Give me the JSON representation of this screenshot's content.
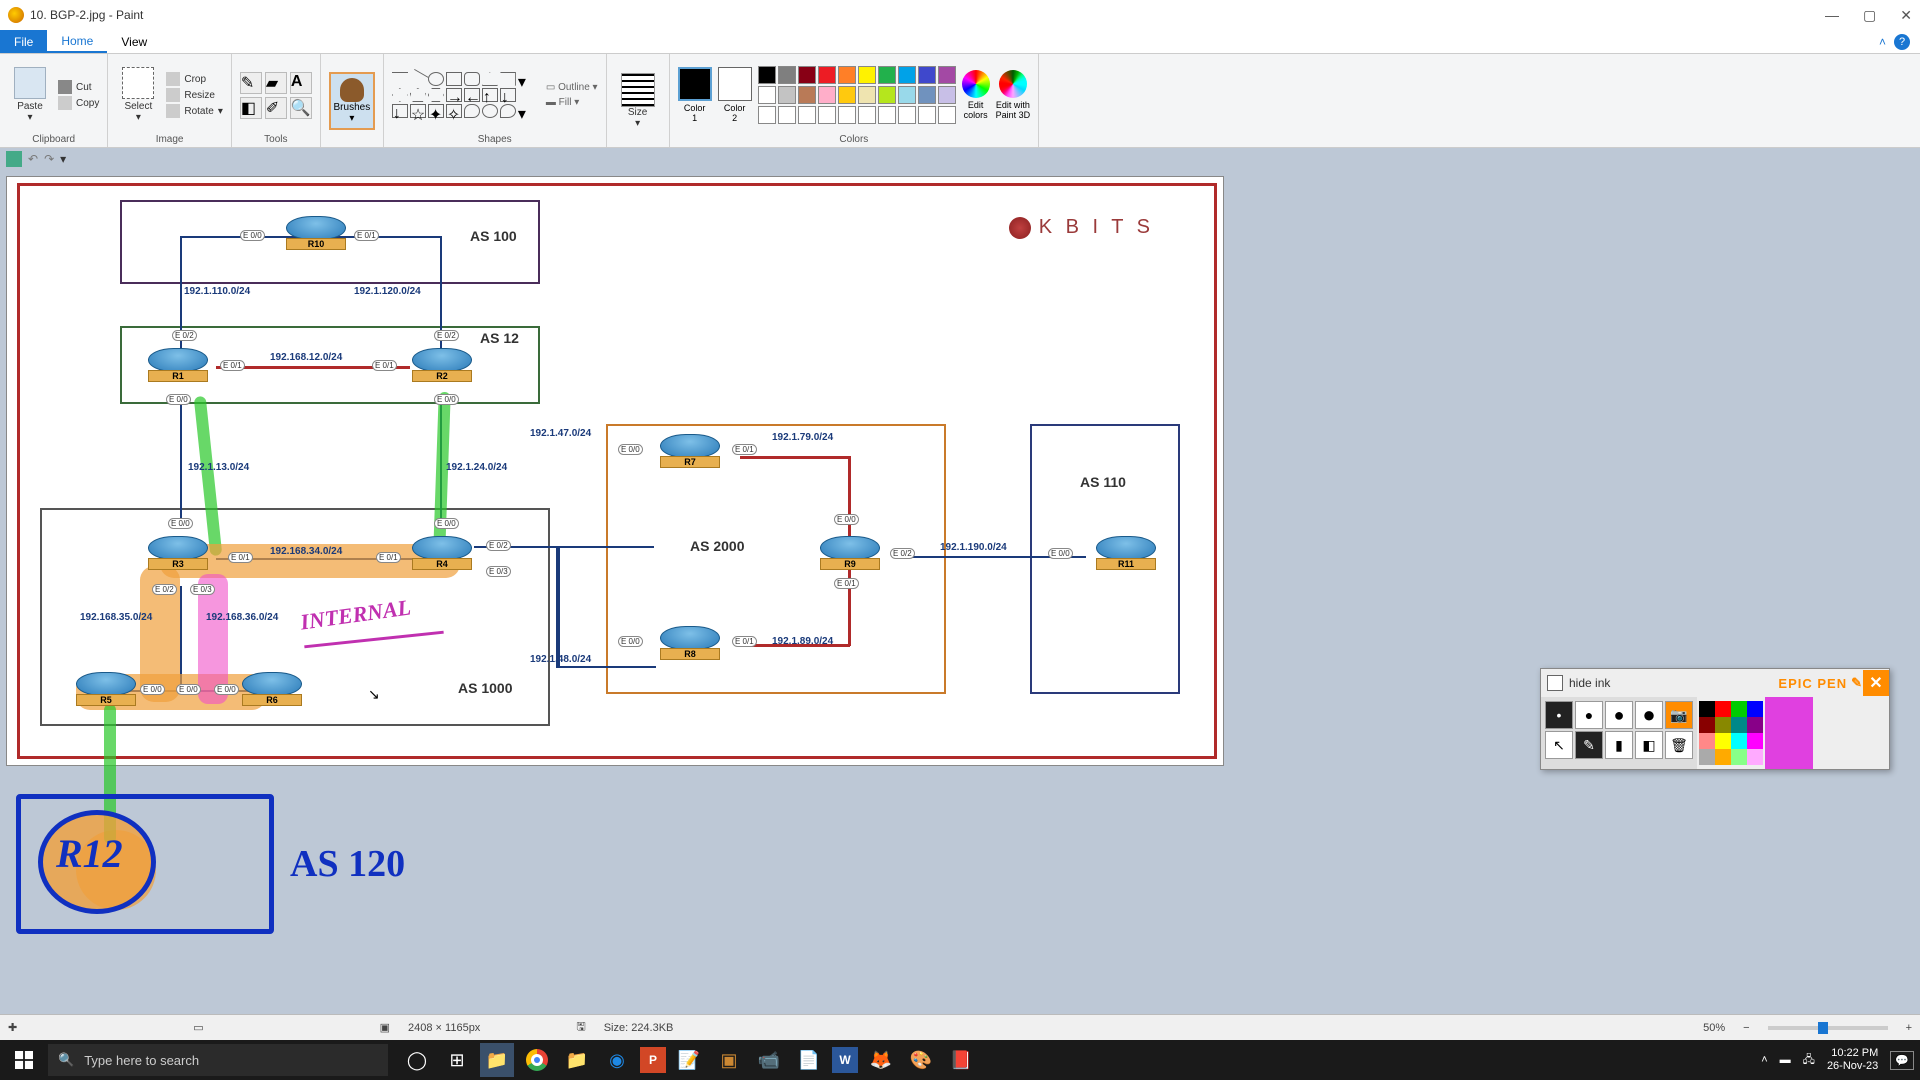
{
  "window": {
    "title": "10. BGP-2.jpg - Paint"
  },
  "menu": {
    "file": "File",
    "home": "Home",
    "view": "View"
  },
  "ribbon": {
    "clipboard": {
      "paste": "Paste",
      "cut": "Cut",
      "copy": "Copy",
      "label": "Clipboard"
    },
    "image": {
      "select": "Select",
      "crop": "Crop",
      "resize": "Resize",
      "rotate": "Rotate",
      "label": "Image"
    },
    "tools": {
      "label": "Tools"
    },
    "brushes": {
      "label": "Brushes"
    },
    "shapes": {
      "outline": "Outline",
      "fill": "Fill",
      "label": "Shapes"
    },
    "size": {
      "label": "Size"
    },
    "colors": {
      "c1": "Color\n1",
      "c2": "Color\n2",
      "edit": "Edit\ncolors",
      "edit3d": "Edit with\nPaint 3D",
      "label": "Colors"
    }
  },
  "palette_colors": [
    "#000",
    "#7f7f7f",
    "#880015",
    "#ed1c24",
    "#ff7f27",
    "#fff200",
    "#22b14c",
    "#00a2e8",
    "#3f48cc",
    "#a349a4",
    "#fff",
    "#c3c3c3",
    "#b97a57",
    "#ffaec9",
    "#ffc90e",
    "#efe4b0",
    "#b5e61d",
    "#99d9ea",
    "#7092be",
    "#c8bfe7"
  ],
  "diagram": {
    "brand": "K B I T S",
    "as_labels": {
      "as100": "AS 100",
      "as12": "AS 12",
      "as1000": "AS 1000",
      "as2000": "AS 2000",
      "as110": "AS 110"
    },
    "routers": {
      "r1": "R1",
      "r2": "R2",
      "r3": "R3",
      "r4": "R4",
      "r5": "R5",
      "r6": "R6",
      "r7": "R7",
      "r8": "R8",
      "r9": "R9",
      "r10": "R10",
      "r11": "R11"
    },
    "nets": {
      "n110": "192.1.110.0/24",
      "n120": "192.1.120.0/24",
      "n12": "192.168.12.0/24",
      "n13": "192.1.13.0/24",
      "n24": "192.1.24.0/24",
      "n34": "192.168.34.0/24",
      "n35": "192.168.35.0/24",
      "n36": "192.168.36.0/24",
      "n47": "192.1.47.0/24",
      "n48": "192.1.48.0/24",
      "n79": "192.1.79.0/24",
      "n89": "192.1.89.0/24",
      "n190": "192.1.190.0/24"
    },
    "ifs": {
      "e00": "E 0/0",
      "e01": "E 0/1",
      "e02": "E 0/2",
      "e03": "E 0/3"
    },
    "annotation": "INTERNAL",
    "hand_r12": "R12",
    "hand_as120": "AS 120"
  },
  "status": {
    "dims": "2408 × 1165px",
    "size": "Size: 224.3KB",
    "zoom": "50%"
  },
  "taskbar": {
    "search_placeholder": "Type here to search"
  },
  "tray": {
    "time": "10:22 PM",
    "date": "26-Nov-23"
  },
  "epic_pen": {
    "hide": "hide ink",
    "brand": "EPIC PEN"
  },
  "ep_colors": [
    "#000",
    "#f00",
    "#0c0",
    "#00f",
    "#800",
    "#880",
    "#088",
    "#808",
    "#f88",
    "#ff0",
    "#0ff",
    "#f0f",
    "#aaa",
    "#fa0",
    "#8f8",
    "#faf"
  ]
}
